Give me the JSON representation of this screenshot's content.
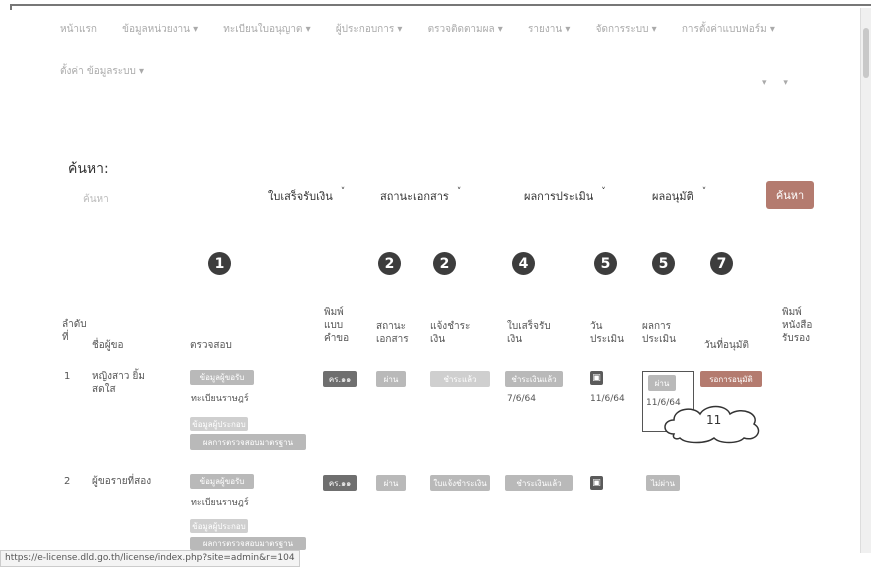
{
  "nav": {
    "items": [
      "หน้าแรก",
      "ข้อมูลหน่วยงาน ▾",
      "ทะเบียนใบอนุญาต ▾",
      "ผู้ประกอบการ ▾",
      "ตรวจติดตามผล ▾",
      "รายงาน ▾",
      "จัดการระบบ ▾",
      "การตั้งค่าแบบฟอร์ม ▾"
    ],
    "second_row": "ตั้งค่า ข้อมูลระบบ ▾",
    "right_items": [
      "▾",
      "▾"
    ]
  },
  "search": {
    "title": "ค้นหา:",
    "placeholder": "ค้นหา",
    "filters": [
      "ใบเสร็จรับเงิน",
      "สถานะเอกสาร",
      "ผลการประเมิน",
      "ผลอนุมัติ"
    ],
    "button": "ค้นหา"
  },
  "steps": [
    "1",
    "2",
    "2",
    "4",
    "5",
    "5",
    "7"
  ],
  "table": {
    "headers": [
      "ลำดับที่",
      "ชื่อผู้ขอ",
      "ตรวจสอบ",
      "พิมพ์แบบคำขอ",
      "สถานะเอกสาร",
      "แจ้งชำระเงิน",
      "ใบเสร็จรับเงิน",
      "วันประเมิน",
      "ผลการประเมิน",
      "วันที่อนุมัติ",
      "พิมพ์หนังสือรับรอง"
    ],
    "rows": [
      {
        "no": "1",
        "name": "หญิงสาว ยิ้มสดใส",
        "check_btn": "ข้อมูลผู้ขอรับ",
        "check_text": "ทะเบียนราษฎร์",
        "check_extra": "ข้อมูลผู้ประกอบ",
        "check_standard": "ผลการตรวจสอบมาตรฐาน",
        "print": "คร.๑๑",
        "doc_status": "ผ่าน",
        "payment": "ชำระแล้ว",
        "receipt": "ชำระเงินแล้ว",
        "receipt_date": "7/6/64",
        "eval_date": "11/6/64",
        "result": "ผ่าน",
        "result_date": "11/6/64",
        "approve": "รอการอนุมัติ"
      },
      {
        "no": "2",
        "name": "ผู้ขอรายที่สอง",
        "check_btn": "ข้อมูลผู้ขอรับ",
        "check_text": "ทะเบียนราษฎร์",
        "check_extra": "ข้อมูลผู้ประกอบ",
        "check_standard": "ผลการตรวจสอบมาตรฐาน",
        "print": "คร.๑๑",
        "doc_status": "ผ่าน",
        "payment": "ใบแจ้งชำระเงิน",
        "receipt": "ชำระเงินแล้ว",
        "result": "ไม่ผ่าน"
      }
    ]
  },
  "callout": "11",
  "status_url": "https://e-license.dld.go.th/license/index.php?site=admin&r=104"
}
